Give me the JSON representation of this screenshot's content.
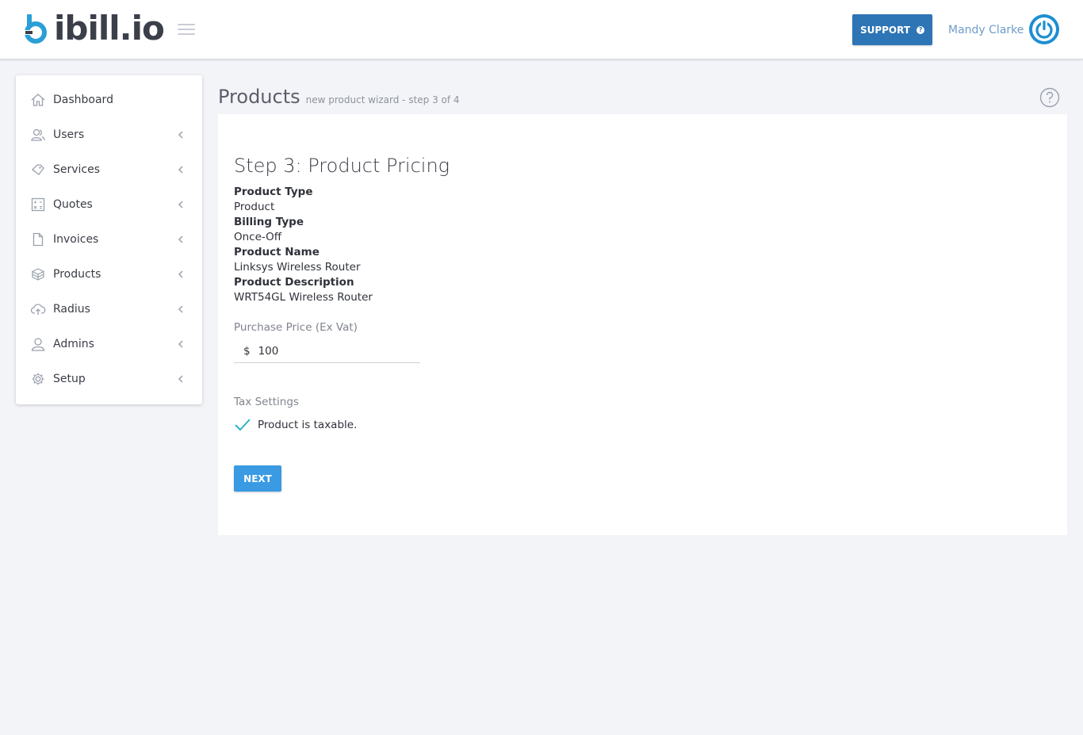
{
  "header": {
    "logo_text": "ibill.io",
    "support_label": "SUPPORT",
    "user_name": "Mandy Clarke",
    "colors": {
      "brand": "#2a9fd6",
      "support": "#2e75b6",
      "user": "#6f9cc8"
    }
  },
  "sidebar": {
    "items": [
      {
        "label": "Dashboard",
        "icon": "home-icon",
        "has_chevron": false
      },
      {
        "label": "Users",
        "icon": "users-icon",
        "has_chevron": true
      },
      {
        "label": "Services",
        "icon": "services-icon",
        "has_chevron": true
      },
      {
        "label": "Quotes",
        "icon": "calculator-icon",
        "has_chevron": true
      },
      {
        "label": "Invoices",
        "icon": "document-icon",
        "has_chevron": true
      },
      {
        "label": "Products",
        "icon": "box-icon",
        "has_chevron": true
      },
      {
        "label": "Radius",
        "icon": "cloud-upload-icon",
        "has_chevron": true
      },
      {
        "label": "Admins",
        "icon": "admin-icon",
        "has_chevron": true
      },
      {
        "label": "Setup",
        "icon": "gear-icon",
        "has_chevron": true
      }
    ]
  },
  "page": {
    "title": "Products",
    "subtitle": "new product wizard - step 3 of 4"
  },
  "wizard": {
    "step_title": "Step 3: Product Pricing",
    "product_type_label": "Product Type",
    "product_type_value": "Product",
    "billing_type_label": "Billing Type",
    "billing_type_value": "Once-Off",
    "product_name_label": "Product Name",
    "product_name_value": "Linksys Wireless Router",
    "product_description_label": "Product Description",
    "product_description_value": "WRT54GL Wireless Router",
    "purchase_price_label": "Purchase Price (Ex Vat)",
    "currency_symbol": "$",
    "purchase_price_value": "100",
    "tax_settings_label": "Tax Settings",
    "taxable_label": "Product is taxable.",
    "taxable_checked": true,
    "next_label": "NEXT",
    "colors": {
      "next": "#3a9ae2",
      "check": "#2bb5c8"
    }
  }
}
